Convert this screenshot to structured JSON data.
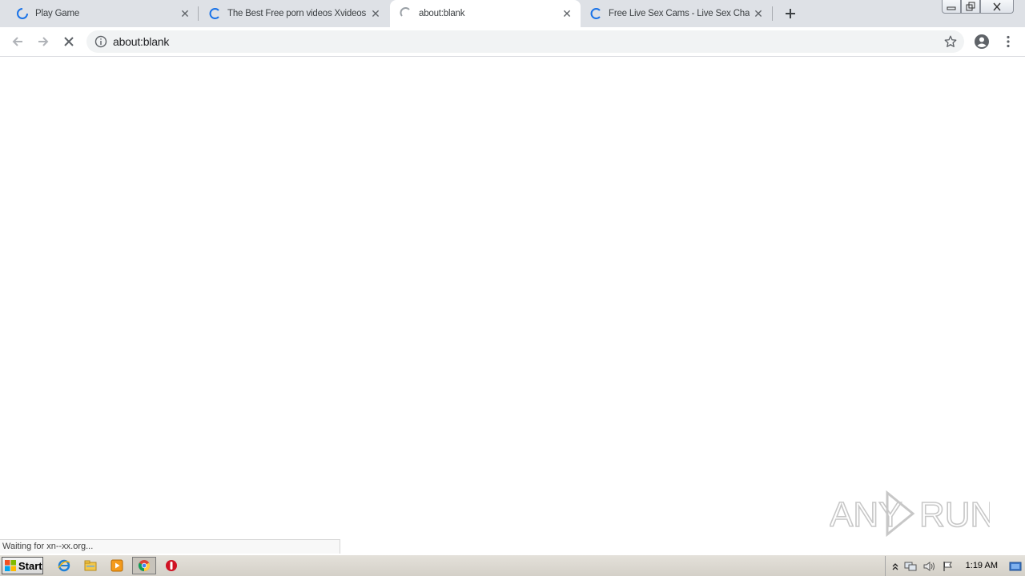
{
  "tabs": [
    {
      "title": "Play Game",
      "state": "loading"
    },
    {
      "title": "The Best Free porn videos Xvideos",
      "state": "loading"
    },
    {
      "title": "about:blank",
      "state": "waiting",
      "active": true
    },
    {
      "title": "Free Live Sex Cams - Live Sex Chat",
      "state": "loading"
    }
  ],
  "toolbar": {
    "url": "about:blank"
  },
  "status": {
    "text": "Waiting for xn--xx.org..."
  },
  "watermark": {
    "text_left": "ANY",
    "text_right": "RUN"
  },
  "taskbar": {
    "start_label": "Start",
    "clock": "1:19 AM"
  },
  "colors": {
    "tab_strip": "#dee1e6",
    "accent_blue": "#1a73e8",
    "omnibox_bg": "#f1f3f4"
  }
}
